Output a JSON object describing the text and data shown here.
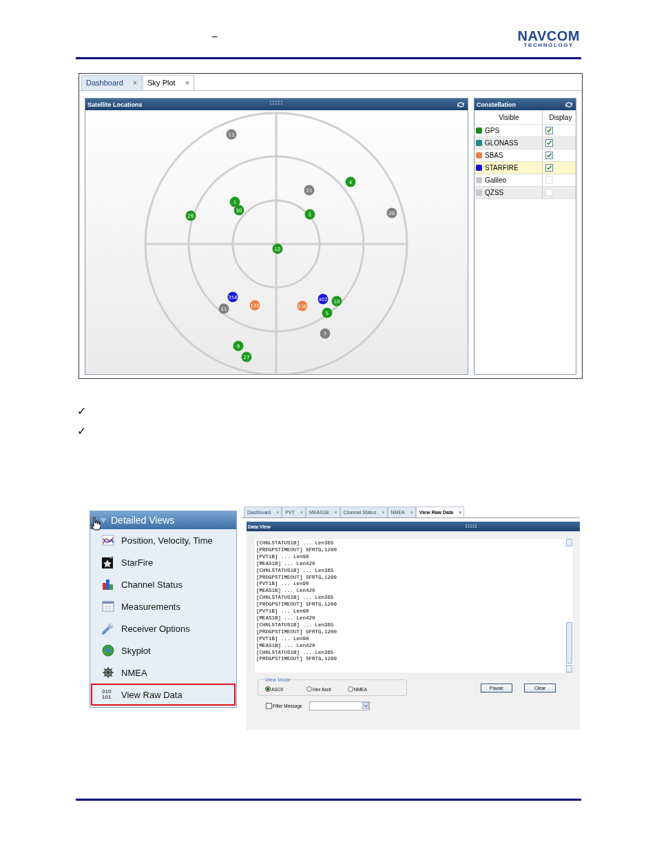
{
  "header": {
    "dash": "–",
    "logo": {
      "top": "NAVCOM",
      "bottom": "TECHNOLOGY"
    }
  },
  "skyplot_window": {
    "tabs": [
      {
        "label": "Dashboard",
        "selected": false,
        "close": "×"
      },
      {
        "label": "Sky Plot",
        "selected": true,
        "close": "×"
      }
    ],
    "satellite_panel": {
      "title": "Satellite Locations",
      "satellites": [
        {
          "label": "13",
          "color": "#808080"
        },
        {
          "label": "4",
          "color": "#1e9a1e"
        },
        {
          "label": "21",
          "color": "#808080"
        },
        {
          "label": "1",
          "color": "#1e9a1e"
        },
        {
          "label": "30",
          "color": "#1e9a1e"
        },
        {
          "label": "29",
          "color": "#1e9a1e"
        },
        {
          "label": "2",
          "color": "#1e9a1e"
        },
        {
          "label": "20",
          "color": "#808080"
        },
        {
          "label": "12",
          "color": "#1e9a1e"
        },
        {
          "label": "358",
          "color": "#1414d8"
        },
        {
          "label": "11",
          "color": "#808080"
        },
        {
          "label": "135",
          "color": "#f08040"
        },
        {
          "label": "138",
          "color": "#f08040"
        },
        {
          "label": "402",
          "color": "#1414d8"
        },
        {
          "label": "10",
          "color": "#1e9a1e"
        },
        {
          "label": "5",
          "color": "#1e9a1e"
        },
        {
          "label": "7",
          "color": "#808080"
        },
        {
          "label": "9",
          "color": "#1e9a1e"
        },
        {
          "label": "27",
          "color": "#1e9a1e"
        }
      ]
    },
    "constellation_panel": {
      "title": "Constellation",
      "columns": [
        "Visible",
        "Display"
      ],
      "rows": [
        {
          "name": "GPS",
          "color": "#1a8a1a",
          "checked": true,
          "selected": false
        },
        {
          "name": "GLONASS",
          "color": "#1a8a8a",
          "checked": true,
          "selected": false
        },
        {
          "name": "SBAS",
          "color": "#f08040",
          "checked": true,
          "selected": false
        },
        {
          "name": "STARFIRE",
          "color": "#1414e0",
          "checked": true,
          "selected": true
        },
        {
          "name": "Galileo",
          "color": "#c8c8c8",
          "checked": false,
          "selected": false
        },
        {
          "name": "QZSS",
          "color": "#c8c8c8",
          "checked": false,
          "selected": false
        }
      ]
    }
  },
  "bullets": [
    {
      "mark": "✓"
    },
    {
      "mark": "✓"
    }
  ],
  "nav_panel": {
    "title": "Detailed Views",
    "items": [
      {
        "label": "Position, Velocity, Time",
        "kind": "chart",
        "selected": false
      },
      {
        "label": "StarFire",
        "kind": "star",
        "selected": false
      },
      {
        "label": "Channel Status",
        "kind": "bars",
        "selected": false
      },
      {
        "label": "Measurements",
        "kind": "table",
        "selected": false
      },
      {
        "label": "Receiver Options",
        "kind": "wrench",
        "selected": false
      },
      {
        "label": "Skyplot",
        "kind": "globe",
        "selected": false
      },
      {
        "label": "NMEA",
        "kind": "wheel",
        "selected": false
      },
      {
        "label": "View Raw Data",
        "kind": "binary",
        "icon_text": [
          "010",
          "101"
        ],
        "selected": true
      }
    ]
  },
  "rawdata_window": {
    "tabs": [
      {
        "label": "Dashboard",
        "selected": false,
        "close": "×"
      },
      {
        "label": "PVT",
        "selected": false,
        "close": "×"
      },
      {
        "label": "MEAS1B",
        "selected": false,
        "close": "×"
      },
      {
        "label": "Channel Status",
        "selected": false,
        "close": "×"
      },
      {
        "label": "NMEA",
        "selected": false,
        "close": "×"
      },
      {
        "label": "View Raw Data",
        "selected": true,
        "close": "×"
      }
    ],
    "panel_title": "Data View",
    "lines": [
      "[CHNLSTATUS1B] ... Len365",
      "[PRDGPSTIMEOUT] SFRTG,1200",
      "[PVT1B] ... Len90",
      "[MEAS1B] ... Len420",
      "[CHNLSTATUS1B] ... Len365",
      "[PRDGPSTIMEOUT] SFRTG,1200",
      "[PVT1B] ... Len90",
      "[MEAS1B] ... Len420",
      "[CHNLSTATUS1B] ... Len365",
      "[PRDGPSTIMEOUT] SFRTG,1200",
      "[PVT1B] ... Len90",
      "[MEAS1B] ... Len420",
      "[CHNLSTATUS1B] ... Len365",
      "[PRDGPSTIMEOUT] SFRTG,1200",
      "[PVT1B] ... Len90",
      "[MEAS1B] ... Len420",
      "[CHNLSTATUS1B] ... Len365",
      "[PRDGPSTIMEOUT] SFRTG,1200"
    ],
    "view_mode": {
      "legend": "View Mode",
      "options": [
        {
          "label": "ASCII",
          "selected": true
        },
        {
          "label": "Hex Ascii",
          "selected": false
        },
        {
          "label": "NMEA",
          "selected": false
        }
      ]
    },
    "buttons": [
      "Pause",
      "Clear"
    ],
    "filter": {
      "label": "Filter Message",
      "checked": false
    }
  }
}
